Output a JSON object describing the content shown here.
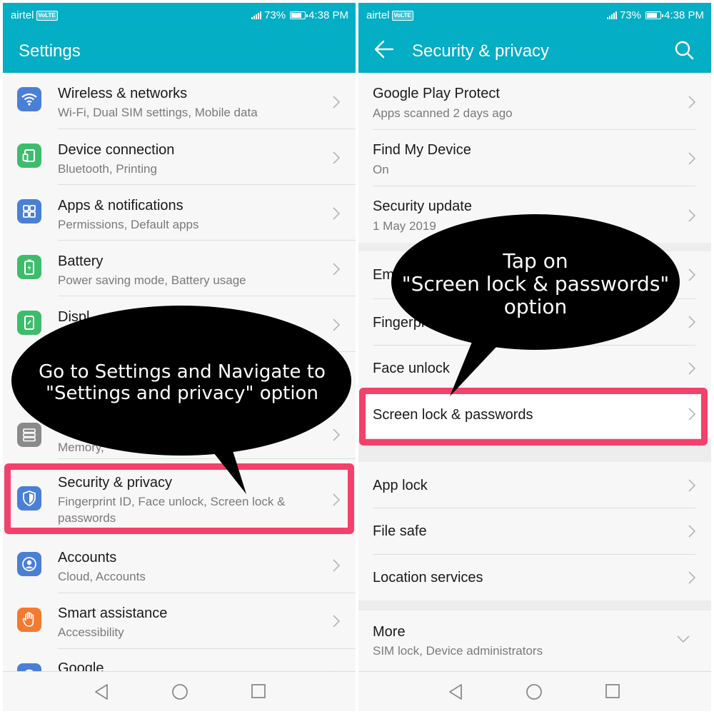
{
  "status_bar": {
    "carrier": "airtel",
    "volte": "VoLTE",
    "battery": "73%",
    "time": "4:38 PM"
  },
  "left_screen": {
    "title": "Settings",
    "items": [
      {
        "title": "Wireless & networks",
        "subtitle": "Wi-Fi, Dual SIM settings, Mobile data",
        "icon": "wifi-icon",
        "color": "#4a7fd6"
      },
      {
        "title": "Device connection",
        "subtitle": "Bluetooth, Printing",
        "icon": "device-connection-icon",
        "color": "#3dbd6b"
      },
      {
        "title": "Apps & notifications",
        "subtitle": "Permissions, Default apps",
        "icon": "apps-grid-icon",
        "color": "#4a7fd6"
      },
      {
        "title": "Battery",
        "subtitle": "Power saving mode, Battery usage",
        "icon": "battery-icon",
        "color": "#3dbd6b"
      },
      {
        "title": "Displ",
        "subtitle": "",
        "icon": "display-icon",
        "color": "#3dbd6b"
      },
      {
        "title": "",
        "subtitle": "Memory,",
        "icon": "storage-icon",
        "color": "#8a8a8a"
      },
      {
        "title": "Security & privacy",
        "subtitle": "Fingerprint ID, Face unlock, Screen lock &",
        "subtitle2": "passwords",
        "icon": "shield-icon",
        "color": "#4a7fd6"
      },
      {
        "title": "Accounts",
        "subtitle": "Cloud, Accounts",
        "icon": "account-icon",
        "color": "#4a7fd6"
      },
      {
        "title": "Smart assistance",
        "subtitle": "Accessibility",
        "icon": "hand-icon",
        "color": "#f47a30"
      },
      {
        "title": "Google",
        "subtitle": "",
        "icon": "google-icon",
        "color": "#4a7fd6"
      }
    ],
    "callout": {
      "line1": "Go to Settings and Navigate to",
      "line2": "\"Settings and privacy\" option"
    }
  },
  "right_screen": {
    "title": "Security & privacy",
    "items": [
      {
        "title": "Google Play Protect",
        "subtitle": "Apps scanned 2 days ago"
      },
      {
        "title": "Find My Device",
        "subtitle": "On"
      },
      {
        "title": "Security update",
        "subtitle": "1 May 2019"
      },
      {
        "title": "Em",
        "subtitle": ""
      },
      {
        "title": "Fingerpr",
        "subtitle": ""
      },
      {
        "title": "Face unlock",
        "subtitle": ""
      },
      {
        "title": "Screen lock & passwords",
        "subtitle": ""
      },
      {
        "title": "App lock",
        "subtitle": ""
      },
      {
        "title": "File safe",
        "subtitle": ""
      },
      {
        "title": "Location services",
        "subtitle": ""
      },
      {
        "title": "More",
        "subtitle": "SIM lock, Device administrators"
      }
    ],
    "callout": {
      "line1": "Tap on",
      "line2": "\"Screen lock & passwords\"",
      "line3": "option"
    }
  },
  "colors": {
    "appbar": "#04aec5",
    "highlight": "#f2416b",
    "callout": "#000000"
  }
}
